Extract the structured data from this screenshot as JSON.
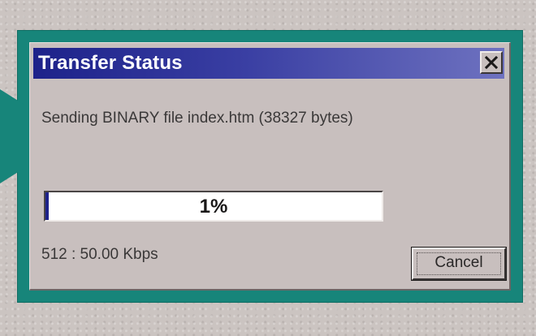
{
  "dialog": {
    "title": "Transfer Status",
    "close_icon": "close-x-icon",
    "message": "Sending BINARY file index.htm (38327 bytes)",
    "progress": {
      "percent_label": "1%",
      "value": 0.01
    },
    "rate": "512 : 50.00 Kbps",
    "cancel_label": "Cancel"
  },
  "colors": {
    "titlebar": "#1d228a",
    "frame_accent": "#17857a",
    "dialog_face": "#c8bfbe"
  }
}
